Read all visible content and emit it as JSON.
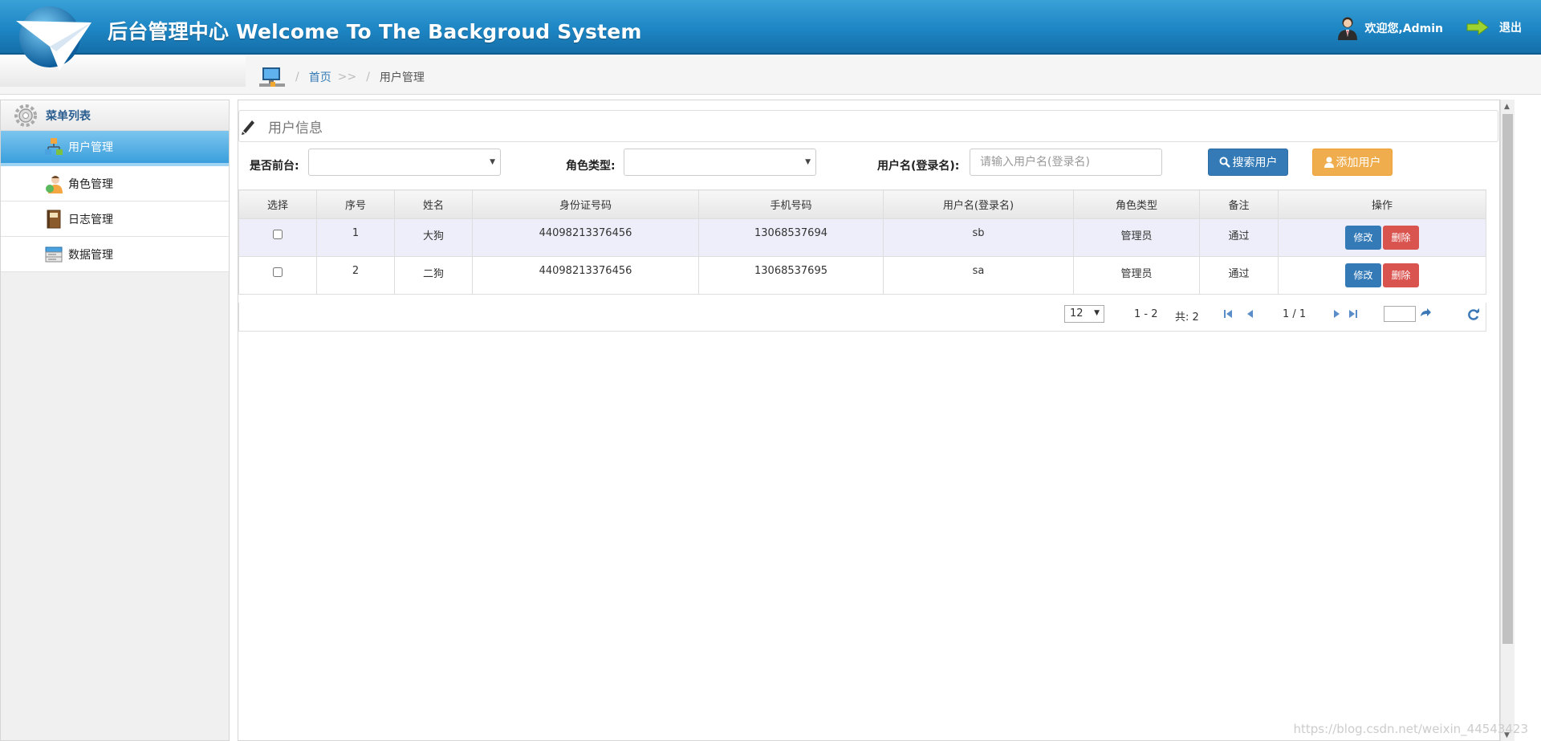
{
  "header": {
    "title": "后台管理中心 Welcome To The Backgroud System",
    "welcome": "欢迎您,Admin",
    "logout": "退出"
  },
  "breadcrumb": {
    "sep": "/",
    "home": "首页",
    "arrow": ">>",
    "current": "用户管理"
  },
  "sidebar": {
    "title": "菜单列表",
    "items": [
      {
        "label": "用户管理",
        "icon": "user-manage-icon"
      },
      {
        "label": "角色管理",
        "icon": "role-manage-icon"
      },
      {
        "label": "日志管理",
        "icon": "log-book-icon"
      },
      {
        "label": "数据管理",
        "icon": "data-manage-icon"
      }
    ]
  },
  "panel": {
    "title": "用户信息"
  },
  "filters": {
    "front_label": "是否前台:",
    "role_label": "角色类型:",
    "username_label": "用户名(登录名):",
    "username_placeholder": "请输入用户名(登录名)",
    "search_button": "搜索用户",
    "add_button": "添加用户"
  },
  "table": {
    "headers": [
      "选择",
      "序号",
      "姓名",
      "身份证号码",
      "手机号码",
      "用户名(登录名)",
      "角色类型",
      "备注",
      "操作"
    ],
    "rows": [
      {
        "index": "1",
        "name": "大狗",
        "id_card": "44098213376456",
        "phone": "13068537694",
        "username": "sb",
        "role": "管理员",
        "remark": "通过"
      },
      {
        "index": "2",
        "name": "二狗",
        "id_card": "44098213376456",
        "phone": "13068537695",
        "username": "sa",
        "role": "管理员",
        "remark": "通过"
      }
    ],
    "edit_label": "修改",
    "delete_label": "删除"
  },
  "pager": {
    "page_size": "12",
    "range": "1 - 2",
    "total": "共: 2",
    "page": "1 / 1"
  },
  "watermark": "https://blog.csdn.net/weixin_44543423",
  "colors": {
    "header": "#1d86c4",
    "primary": "#337ab7",
    "warning": "#f0ad4e",
    "danger": "#d9534f"
  }
}
